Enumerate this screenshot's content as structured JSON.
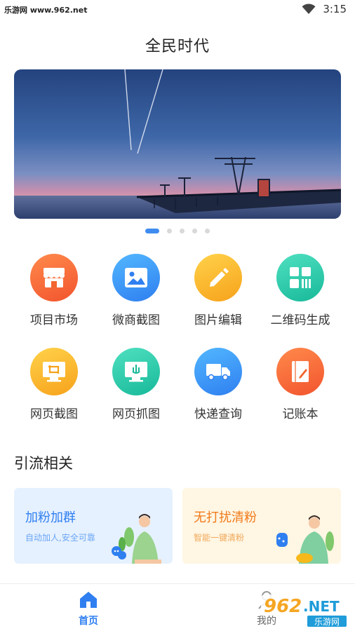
{
  "status_bar": {
    "watermark": "乐游网 www.962.net",
    "time": "3:15"
  },
  "header": {
    "title": "全民时代"
  },
  "carousel": {
    "page_count": 5,
    "active_index": 0
  },
  "grid": {
    "items": [
      {
        "label": "项目市场",
        "icon": "shop-icon",
        "color_from": "#ff8a4c",
        "color_to": "#f2542d"
      },
      {
        "label": "微商截图",
        "icon": "image-icon",
        "color_from": "#52b7ff",
        "color_to": "#2f7ff0"
      },
      {
        "label": "图片编辑",
        "icon": "pencil-icon",
        "color_from": "#ffd24a",
        "color_to": "#f7a21b"
      },
      {
        "label": "二维码生成",
        "icon": "qrcode-icon",
        "color_from": "#4fe0c0",
        "color_to": "#17b99a"
      },
      {
        "label": "网页截图",
        "icon": "screen-crop-icon",
        "color_from": "#ffd24a",
        "color_to": "#f7a21b"
      },
      {
        "label": "网页抓图",
        "icon": "screen-capture-icon",
        "color_from": "#4fe0c0",
        "color_to": "#17b99a"
      },
      {
        "label": "快递查询",
        "icon": "truck-icon",
        "color_from": "#52b7ff",
        "color_to": "#2f7ff0"
      },
      {
        "label": "记账本",
        "icon": "notebook-icon",
        "color_from": "#ff8a4c",
        "color_to": "#f2542d"
      }
    ]
  },
  "section": {
    "title": "引流相关"
  },
  "cards": [
    {
      "title": "加粉加群",
      "subtitle": "自动加人,安全可靠",
      "bg": "#e6f1ff",
      "title_color": "#2f7ff0",
      "sub_color": "#6aa6f3"
    },
    {
      "title": "无打扰清粉",
      "subtitle": "智能一键清粉",
      "bg": "#fff6e3",
      "title_color": "#f07a1a",
      "sub_color": "#f0a85a"
    }
  ],
  "bottom_nav": {
    "items": [
      {
        "label": "首页",
        "icon": "home-icon",
        "active": true
      },
      {
        "label": "我的",
        "icon": "user-icon",
        "active": false
      }
    ],
    "active_color": "#2f7ff0"
  },
  "watermark": {
    "text": "962.NET",
    "sub": "乐游网"
  }
}
